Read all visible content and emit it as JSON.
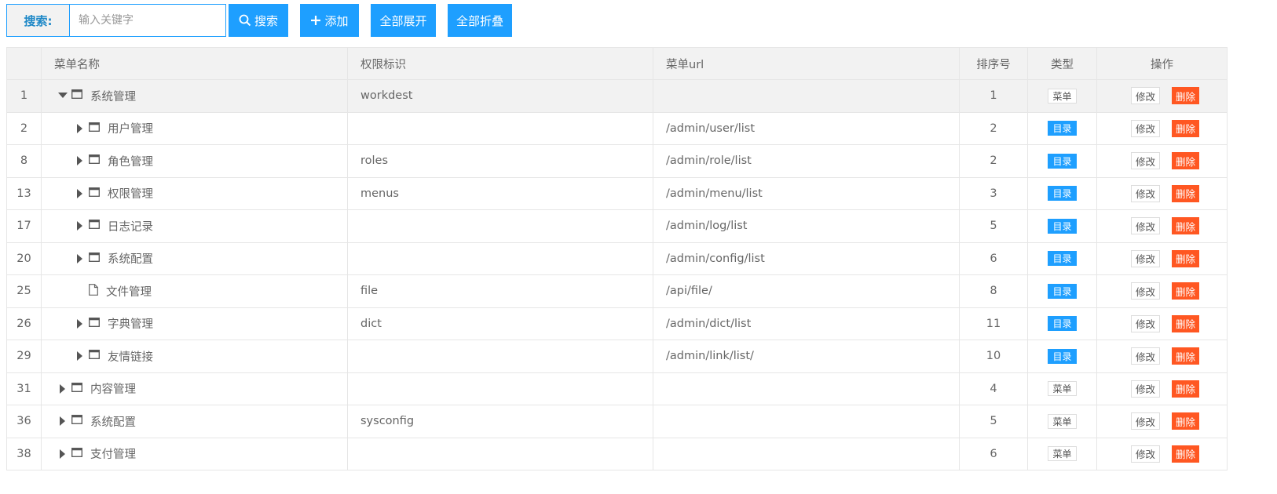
{
  "search": {
    "label": "搜索:",
    "placeholder": "输入关键字",
    "value": ""
  },
  "toolbar": {
    "search_label": "搜索",
    "add_label": "添加",
    "expand_label": "全部展开",
    "collapse_label": "全部折叠"
  },
  "table": {
    "headers": {
      "id": "",
      "name": "菜单名称",
      "perm": "权限标识",
      "url": "菜单url",
      "sort": "排序号",
      "type": "类型",
      "op": "操作"
    },
    "edit_label": "修改",
    "delete_label": "删除",
    "rows": [
      {
        "id": "1",
        "name": "系统管理",
        "perm": "workdest",
        "url": "",
        "sort": "1",
        "type": "菜单",
        "level": 0,
        "toggle": "expanded",
        "icon": "window-icon"
      },
      {
        "id": "2",
        "name": "用户管理",
        "perm": "",
        "url": "/admin/user/list",
        "sort": "2",
        "type": "目录",
        "level": 1,
        "toggle": "collapsed",
        "icon": "window-icon"
      },
      {
        "id": "8",
        "name": "角色管理",
        "perm": "roles",
        "url": "/admin/role/list",
        "sort": "2",
        "type": "目录",
        "level": 1,
        "toggle": "collapsed",
        "icon": "window-icon"
      },
      {
        "id": "13",
        "name": "权限管理",
        "perm": "menus",
        "url": "/admin/menu/list",
        "sort": "3",
        "type": "目录",
        "level": 1,
        "toggle": "collapsed",
        "icon": "window-icon"
      },
      {
        "id": "17",
        "name": "日志记录",
        "perm": "",
        "url": "/admin/log/list",
        "sort": "5",
        "type": "目录",
        "level": 1,
        "toggle": "collapsed",
        "icon": "window-icon"
      },
      {
        "id": "20",
        "name": "系统配置",
        "perm": "",
        "url": "/admin/config/list",
        "sort": "6",
        "type": "目录",
        "level": 1,
        "toggle": "collapsed",
        "icon": "window-icon"
      },
      {
        "id": "25",
        "name": "文件管理",
        "perm": "file",
        "url": "/api/file/",
        "sort": "8",
        "type": "目录",
        "level": 1,
        "toggle": "none",
        "icon": "file-icon"
      },
      {
        "id": "26",
        "name": "字典管理",
        "perm": "dict",
        "url": "/admin/dict/list",
        "sort": "11",
        "type": "目录",
        "level": 1,
        "toggle": "collapsed",
        "icon": "window-icon"
      },
      {
        "id": "29",
        "name": "友情链接",
        "perm": "",
        "url": "/admin/link/list/",
        "sort": "10",
        "type": "目录",
        "level": 1,
        "toggle": "collapsed",
        "icon": "window-icon"
      },
      {
        "id": "31",
        "name": "内容管理",
        "perm": "",
        "url": "",
        "sort": "4",
        "type": "菜单",
        "level": 0,
        "toggle": "collapsed",
        "icon": "window-icon"
      },
      {
        "id": "36",
        "name": "系统配置",
        "perm": "sysconfig",
        "url": "",
        "sort": "5",
        "type": "菜单",
        "level": 0,
        "toggle": "collapsed",
        "icon": "window-icon"
      },
      {
        "id": "38",
        "name": "支付管理",
        "perm": "",
        "url": "",
        "sort": "6",
        "type": "菜单",
        "level": 0,
        "toggle": "collapsed",
        "icon": "window-icon"
      }
    ]
  },
  "colors": {
    "primary": "#1e9fff",
    "danger": "#ff5722",
    "header_bg": "#f2f2f2"
  }
}
